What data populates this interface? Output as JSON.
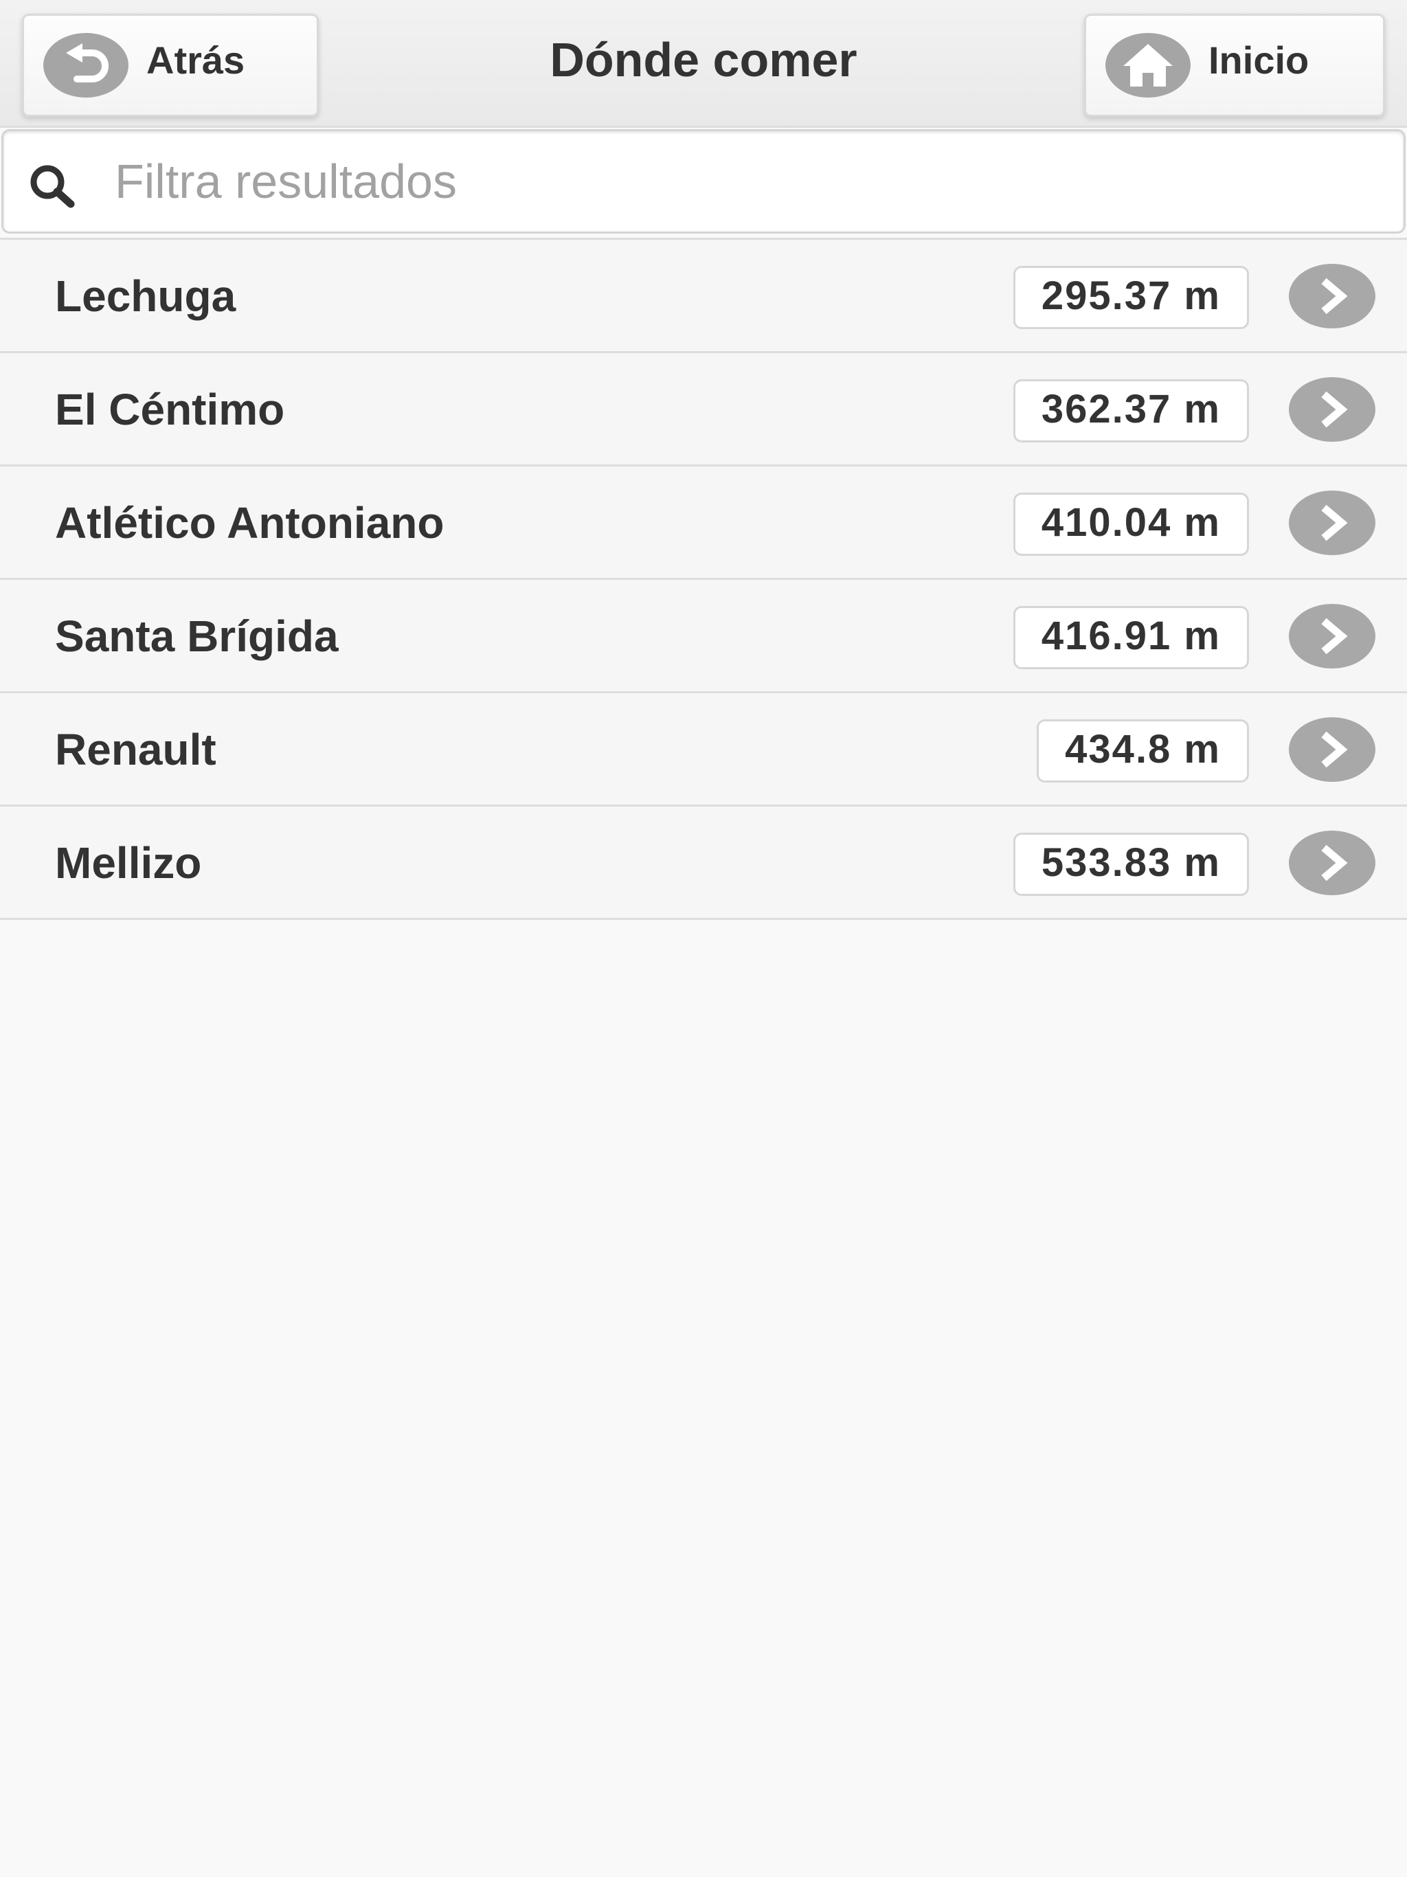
{
  "header": {
    "title": "Dónde comer",
    "back": {
      "label": "Atrás",
      "icon": "back-arrow-icon"
    },
    "home": {
      "label": "Inicio",
      "icon": "home-icon"
    }
  },
  "search": {
    "placeholder": "Filtra resultados",
    "value": "",
    "icon": "search-icon"
  },
  "results": [
    {
      "name": "Lechuga",
      "distance": "295.37 m"
    },
    {
      "name": "El Céntimo",
      "distance": "362.37 m"
    },
    {
      "name": "Atlético Antoniano",
      "distance": "410.04 m"
    },
    {
      "name": "Santa Brígida",
      "distance": "416.91 m"
    },
    {
      "name": "Renault",
      "distance": "434.8 m"
    },
    {
      "name": "Mellizo",
      "distance": "533.83 m"
    }
  ],
  "colors": {
    "icon_bg": "#a8a8a8",
    "text": "#333333",
    "placeholder": "#a2a2a2"
  }
}
